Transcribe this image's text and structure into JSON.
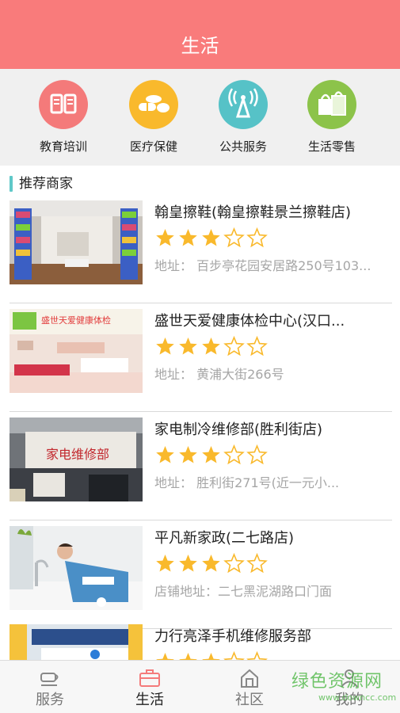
{
  "header": {
    "title": "生活"
  },
  "categories": [
    {
      "label": "教育培训",
      "icon": "book-icon",
      "color": "#f47a7a"
    },
    {
      "label": "医疗保健",
      "icon": "pills-icon",
      "color": "#f9b92c"
    },
    {
      "label": "公共服务",
      "icon": "signal-tower-icon",
      "color": "#56c2c7"
    },
    {
      "label": "生活零售",
      "icon": "shopping-bag-icon",
      "color": "#8cc34a"
    }
  ],
  "section": {
    "title": "推荐商家"
  },
  "merchants": [
    {
      "name": "翰皇擦鞋(翰皇擦鞋景兰擦鞋店)",
      "rating": 3.5,
      "address": "地址：  百步亭花园安居路250号103..."
    },
    {
      "name": "盛世天爱健康体检中心(汉口...",
      "rating": 3.5,
      "address": "地址：  黄浦大街266号",
      "sign_text": "盛世天爱健康体检"
    },
    {
      "name": "家电制冷维修部(胜利街店)",
      "rating": 3.5,
      "address": "地址：  胜利街271号(近一元小...",
      "sign_text": "家电维修部"
    },
    {
      "name": "平凡新家政(二七路店)",
      "rating": 3.5,
      "address": "店铺地址：二七黑泥湖路口门面"
    },
    {
      "name": "力行亮泽手机维修服务部",
      "rating": 3.5,
      "address": ""
    }
  ],
  "tabs": [
    {
      "label": "服务",
      "icon": "cup-icon",
      "active": false
    },
    {
      "label": "生活",
      "icon": "briefcase-icon",
      "active": true
    },
    {
      "label": "社区",
      "icon": "house-icon",
      "active": false
    },
    {
      "label": "我的",
      "icon": "person-icon",
      "active": false
    }
  ],
  "watermark": {
    "text": "绿色资源网",
    "url": "www.downcc.com"
  },
  "colors": {
    "header": "#f97b7b",
    "star": "#f9b92c",
    "accent_bar": "#5fc8c8",
    "active_tab_icon": "#f47a7a"
  }
}
